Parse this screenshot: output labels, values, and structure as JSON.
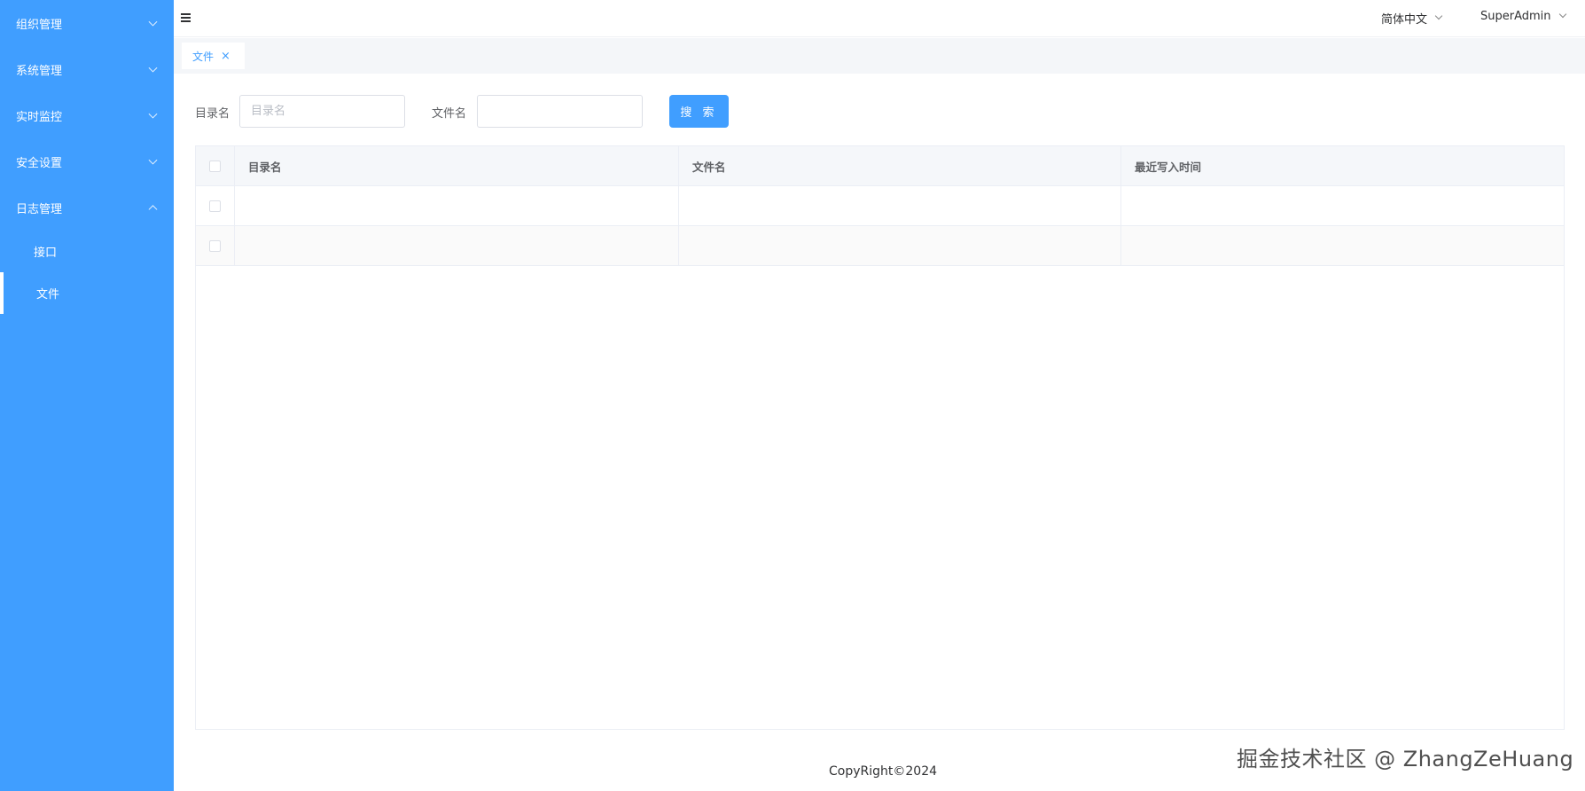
{
  "sidebar": {
    "menus": [
      {
        "label": "组织管理",
        "expanded": false
      },
      {
        "label": "系统管理",
        "expanded": false
      },
      {
        "label": "实时监控",
        "expanded": false
      },
      {
        "label": "安全设置",
        "expanded": false
      },
      {
        "label": "日志管理",
        "expanded": true
      }
    ],
    "submenu": [
      {
        "label": "接口",
        "active": false
      },
      {
        "label": "文件",
        "active": true
      }
    ]
  },
  "header": {
    "language": "简体中文",
    "user": "SuperAdmin"
  },
  "tags": [
    {
      "label": "文件",
      "close": "×"
    }
  ],
  "search": {
    "dir_label": "目录名",
    "dir_placeholder": "目录名",
    "dir_value": "",
    "file_label": "文件名",
    "file_placeholder": "",
    "file_value": "",
    "button": "搜 索"
  },
  "table": {
    "columns": [
      "目录名",
      "文件名",
      "最近写入时间"
    ],
    "rows": [
      [
        "",
        "",
        ""
      ],
      [
        "",
        "",
        ""
      ]
    ]
  },
  "footer": {
    "copyright": "CopyRight©2024",
    "watermark": "掘金技术社区 @ ZhangZeHuang"
  },
  "colors": {
    "primary": "#409eff",
    "sidebar_bg": "#409eff"
  }
}
